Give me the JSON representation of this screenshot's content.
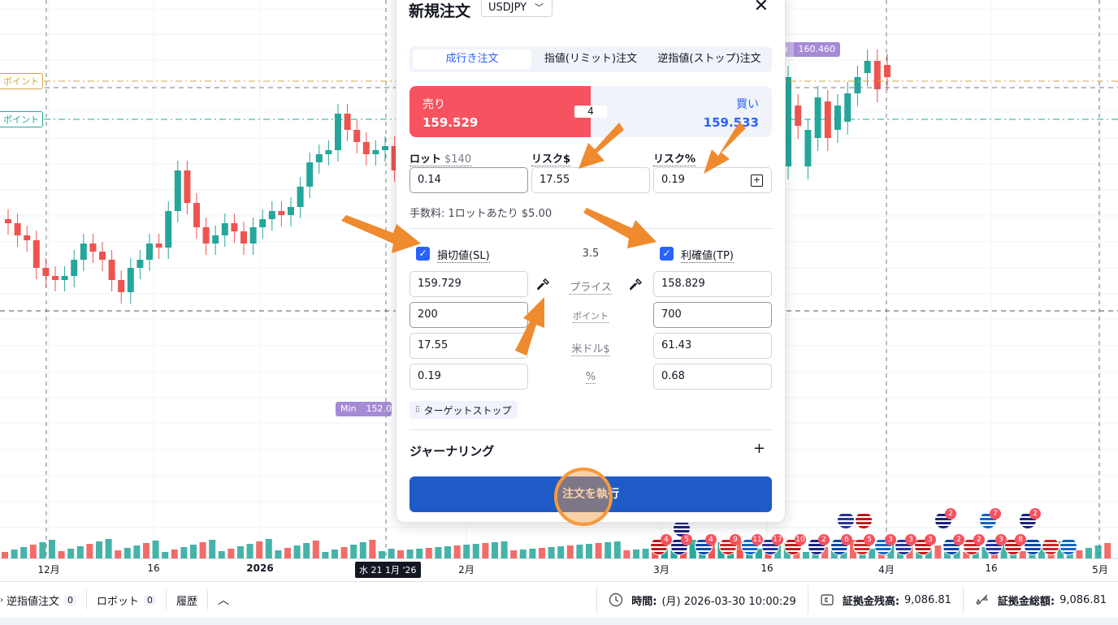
{
  "chart": {
    "price_labels": {
      "max": "160.460",
      "min": "152.0"
    },
    "max_label": "x",
    "min_label": "Min",
    "line_labels": [
      "ポイント",
      "ポイント"
    ],
    "line_label_colors": [
      "#d4a244",
      "#26a69a"
    ],
    "x_labels": [
      "12月",
      "16",
      "2026",
      "2月",
      "3月",
      "16",
      "4月",
      "16",
      "5月"
    ],
    "crosshair_date": "水 21 1月 '26",
    "colors": {
      "up": "#26a69a",
      "down": "#ef5350"
    }
  },
  "bottombar": {
    "stop_orders": {
      "label": "逆指値注文",
      "count": "0"
    },
    "robots": {
      "label": "ロボット",
      "count": "0"
    },
    "history": {
      "label": "履歴"
    },
    "collapse_icon": "chevron-up-icon",
    "time": {
      "label": "時間:",
      "value": "(月) 2026-03-30 10:00:29"
    },
    "balance": {
      "label": "証拠金残高:",
      "value": "9,086.81"
    },
    "equity": {
      "label": "証拠金総額:",
      "value": "9,086.81"
    }
  },
  "order": {
    "title": "新規注文",
    "symbol": "USDJPY",
    "tabs": [
      "成行き注文",
      "指値(リミット)注文",
      "逆指値(ストップ)注文"
    ],
    "active_tab": 0,
    "sell": {
      "label": "売り",
      "price": "159.529"
    },
    "buy": {
      "label": "買い",
      "price": "159.533"
    },
    "spread": "4",
    "lot": {
      "label": "ロット",
      "sub": "$140",
      "value": "0.14"
    },
    "risk_usd": {
      "label": "リスク$",
      "value": "17.55"
    },
    "risk_pct": {
      "label": "リスク%",
      "value": "0.19"
    },
    "fee": "手数料: 1ロットあたり $5.00",
    "sl": {
      "label": "損切値(SL)",
      "checked": true,
      "price": "159.729",
      "points": "200",
      "usd": "17.55",
      "pct": "0.19"
    },
    "tp": {
      "label": "利確値(TP)",
      "checked": true,
      "price": "158.829",
      "points": "700",
      "usd": "61.43",
      "pct": "0.68"
    },
    "ratio": "3.5",
    "row_labels": {
      "price": "プライス",
      "points": "ポイント",
      "usd": "米ドル$",
      "pct": "%"
    },
    "target_stop": "ターゲットストップ",
    "journaling": "ジャーナリング",
    "execute": "注文を執行",
    "accent": "#1e5bc6"
  },
  "events": {
    "badges": [
      "4",
      "5",
      "4",
      "9",
      "11",
      "17",
      "10",
      "2",
      "6",
      "5",
      "3",
      "3",
      "3",
      "2",
      "2",
      "2",
      "7",
      "3",
      "8",
      "2"
    ]
  }
}
